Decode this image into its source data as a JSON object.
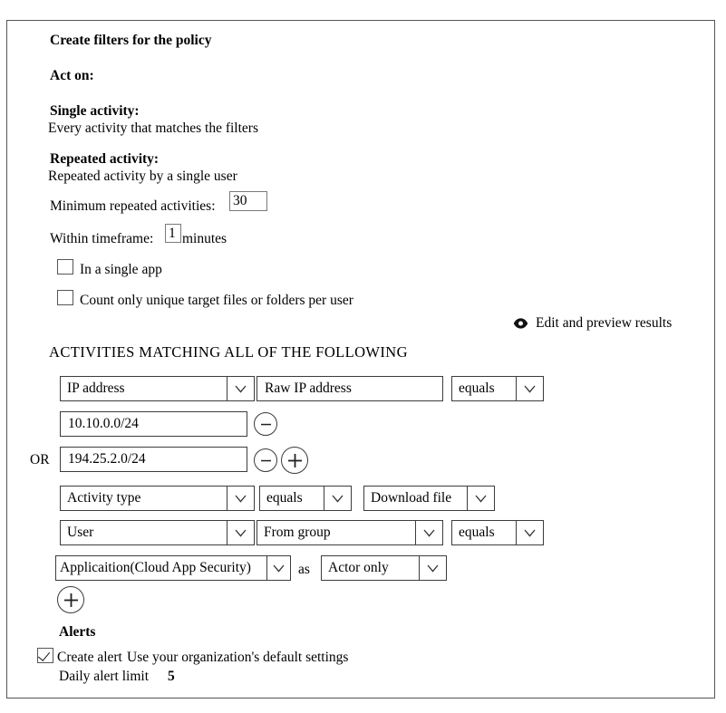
{
  "panel": {
    "title": "Create filters for the policy",
    "act_on_label": "Act on:",
    "single_activity": {
      "heading": "Single activity:",
      "description": "Every activity that matches the filters"
    },
    "repeated_activity": {
      "heading": "Repeated activity:",
      "description": "Repeated activity by a single user",
      "minimum_label": "Minimum repeated activities:",
      "minimum_value": "30",
      "timeframe_label": "Within timeframe:",
      "timeframe_value": "1",
      "timeframe_unit": "minutes",
      "options": [
        {
          "label": "In a single app",
          "checked": false
        },
        {
          "label": "Count only unique target files or folders per user",
          "checked": false
        }
      ]
    },
    "preview_link": {
      "icon": "eye-icon",
      "label": "Edit and preview results"
    },
    "filters": {
      "heading": "ACTIVITIES MATCHING ALL OF THE FOLLOWING",
      "or_label": "OR",
      "as_label": "as",
      "rows": {
        "ip": {
          "attribute": "IP address",
          "qualifier": "Raw IP address",
          "operator": "equals",
          "values": [
            {
              "value": "10.10.0.0/24"
            },
            {
              "value": "194.25.2.0/24"
            }
          ]
        },
        "activity": {
          "attribute": "Activity type",
          "operator": "equals",
          "value": "Download file"
        },
        "user": {
          "attribute": "User",
          "qualifier": "From group",
          "operator": "equals"
        },
        "application": {
          "attribute": "Applicaition(Cloud App Security)",
          "role": "Actor only"
        }
      }
    },
    "alerts": {
      "heading": "Alerts",
      "create_alert": {
        "checked": true,
        "label": "Create alert",
        "settings_text": "Use your organization's default settings"
      },
      "daily_limit_label": "Daily alert limit",
      "daily_limit_value": "5"
    }
  }
}
